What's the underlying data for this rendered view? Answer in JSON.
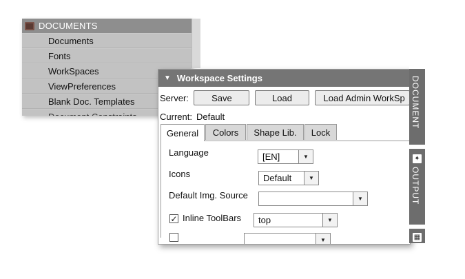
{
  "documents_panel": {
    "title": "DOCUMENTS",
    "items": [
      "Documents",
      "Fonts",
      "WorkSpaces",
      "ViewPreferences",
      "Blank Doc. Templates",
      "Document Constraints"
    ]
  },
  "workspace": {
    "title": "Workspace Settings",
    "server_label": "Server:",
    "buttons": {
      "save": "Save",
      "load": "Load",
      "load_admin": "Load Admin WorkSp"
    },
    "current_label": "Current:",
    "current_value": "Default",
    "tabs": [
      "General",
      "Colors",
      "Shape Lib.",
      "Lock"
    ],
    "active_tab": "General",
    "general": {
      "language_label": "Language",
      "language_value": "[EN]",
      "icons_label": "Icons",
      "icons_value": "Default",
      "img_source_label": "Default Img. Source",
      "img_source_value": "",
      "inline_toolbars_label": "Inline ToolBars",
      "inline_toolbars_checked": true,
      "inline_toolbars_value": "top"
    }
  },
  "dock": {
    "document_label": "DOCUMENT",
    "output_label": "OUTPUT"
  },
  "colors": {
    "title_bar": "#757575",
    "dock": "#6d6d6d",
    "doc_header": "#8e8e8e",
    "doc_body": "#c9c9c9"
  }
}
